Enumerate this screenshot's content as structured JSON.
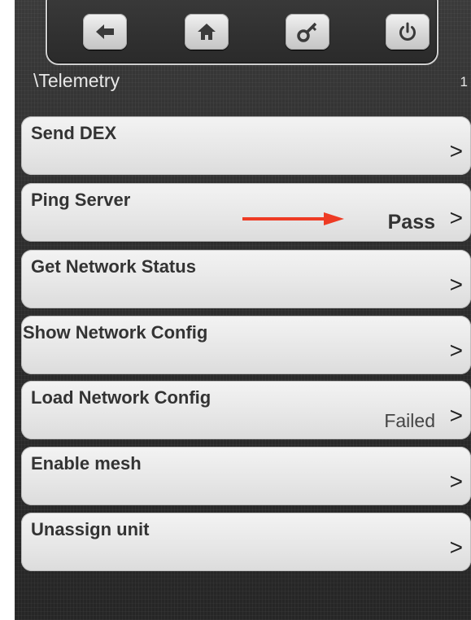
{
  "header": {
    "path": "\\Telemetry",
    "page": "1",
    "buttons": [
      {
        "name": "back-arrow-icon"
      },
      {
        "name": "home-icon"
      },
      {
        "name": "key-icon"
      },
      {
        "name": "power-icon"
      }
    ]
  },
  "menu": {
    "items": [
      {
        "label": "Send DEX",
        "status": "",
        "chevron": ">"
      },
      {
        "label": "Ping Server",
        "status": "Pass",
        "chevron": ">"
      },
      {
        "label": "Get Network Status",
        "status": "",
        "chevron": ">"
      },
      {
        "label": "Show Network Config",
        "status": "",
        "chevron": ">"
      },
      {
        "label": "Load Network Config",
        "status": "Failed",
        "chevron": ">"
      },
      {
        "label": "Enable mesh",
        "status": "",
        "chevron": ">"
      },
      {
        "label": "Unassign unit",
        "status": "",
        "chevron": ">"
      }
    ]
  },
  "colors": {
    "annotation_arrow": "#ee3b24"
  }
}
